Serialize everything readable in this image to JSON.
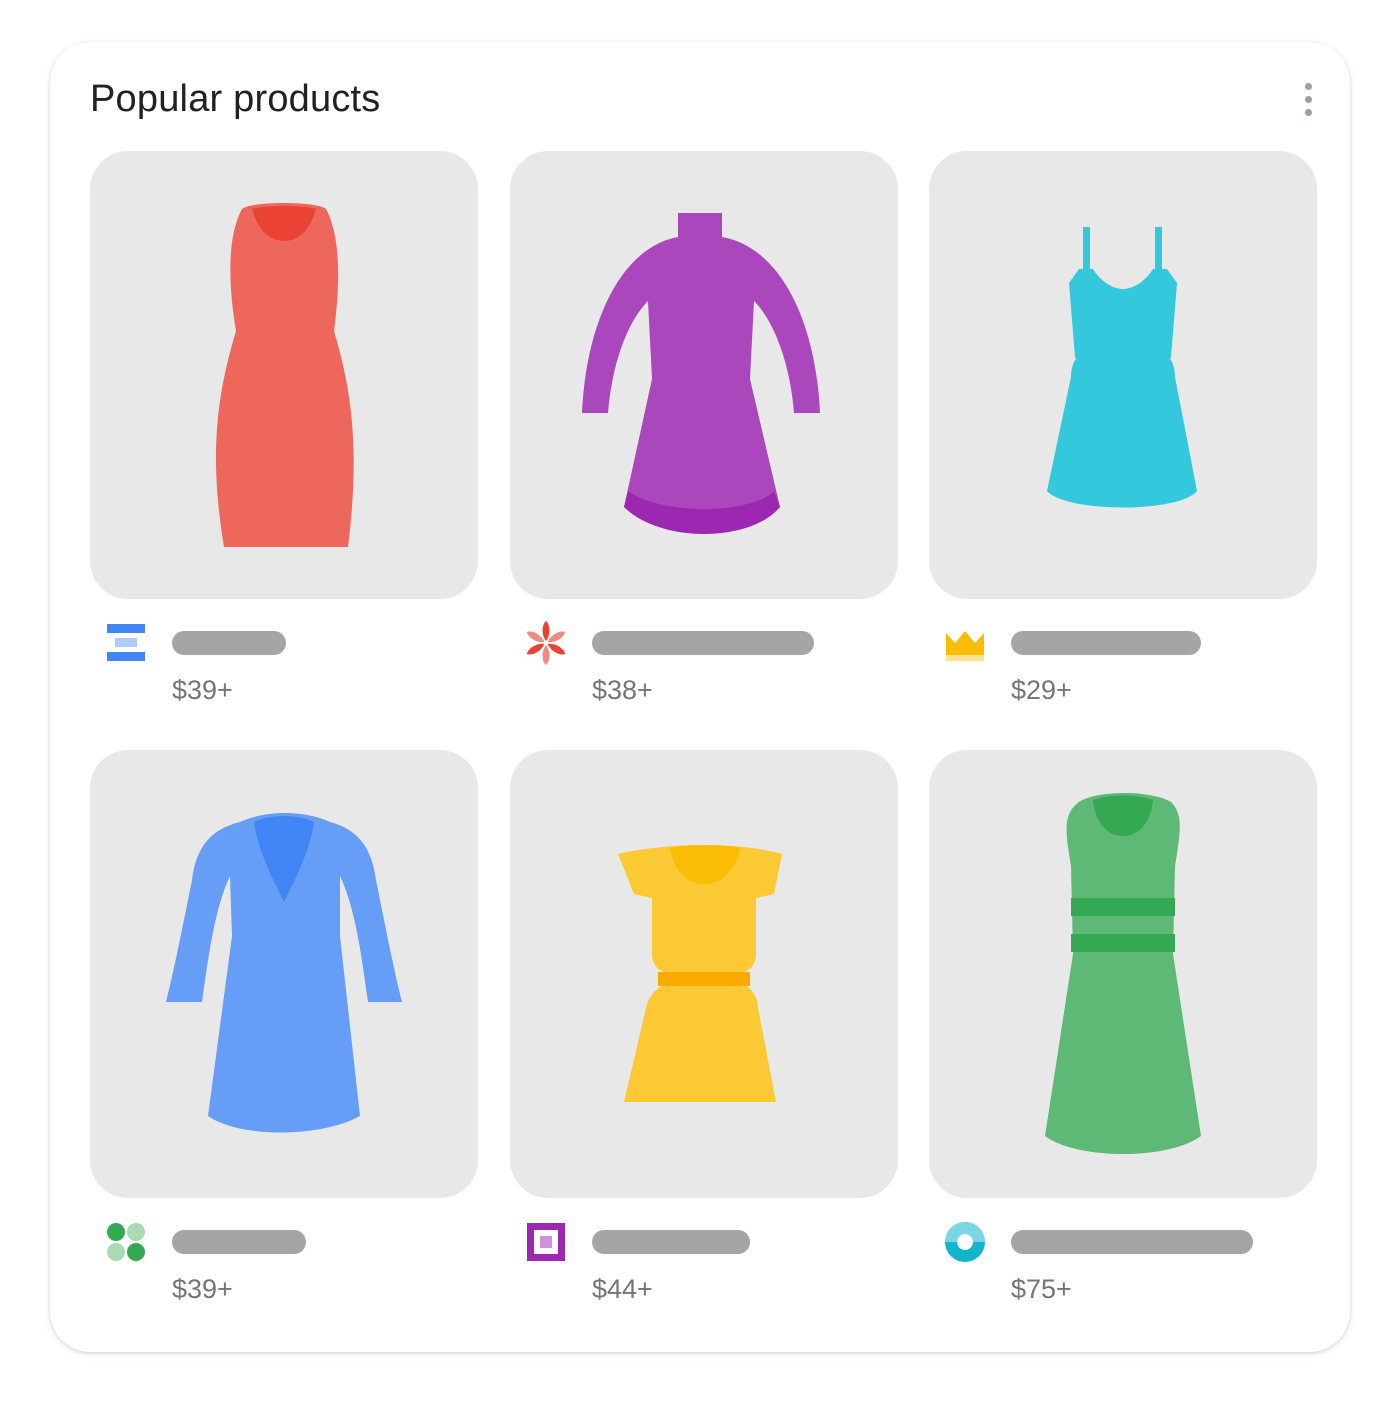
{
  "header": {
    "title": "Popular products",
    "menu_icon": "more-vert-icon"
  },
  "products": [
    {
      "price": "$39+",
      "item": "sleeveless-fitted-dress",
      "color": "#ee675c",
      "merchant_icon": "stacked-bars-logo-icon"
    },
    {
      "price": "$38+",
      "item": "turtleneck-long-sleeve-dress",
      "color": "#af5cf7",
      "merchant_icon": "flower-logo-icon"
    },
    {
      "price": "$29+",
      "item": "spaghetti-strap-dress",
      "color": "#33c8db",
      "merchant_icon": "crown-logo-icon"
    },
    {
      "price": "$39+",
      "item": "v-neck-wrap-coat-dress",
      "color": "#669df6",
      "merchant_icon": "four-dots-logo-icon"
    },
    {
      "price": "$44+",
      "item": "short-sleeve-belted-dress",
      "color": "#fbc933",
      "merchant_icon": "square-frame-logo-icon"
    },
    {
      "price": "$75+",
      "item": "striped-sleeveless-maxi-dress",
      "color": "#5db975",
      "merchant_icon": "ring-logo-icon"
    }
  ]
}
